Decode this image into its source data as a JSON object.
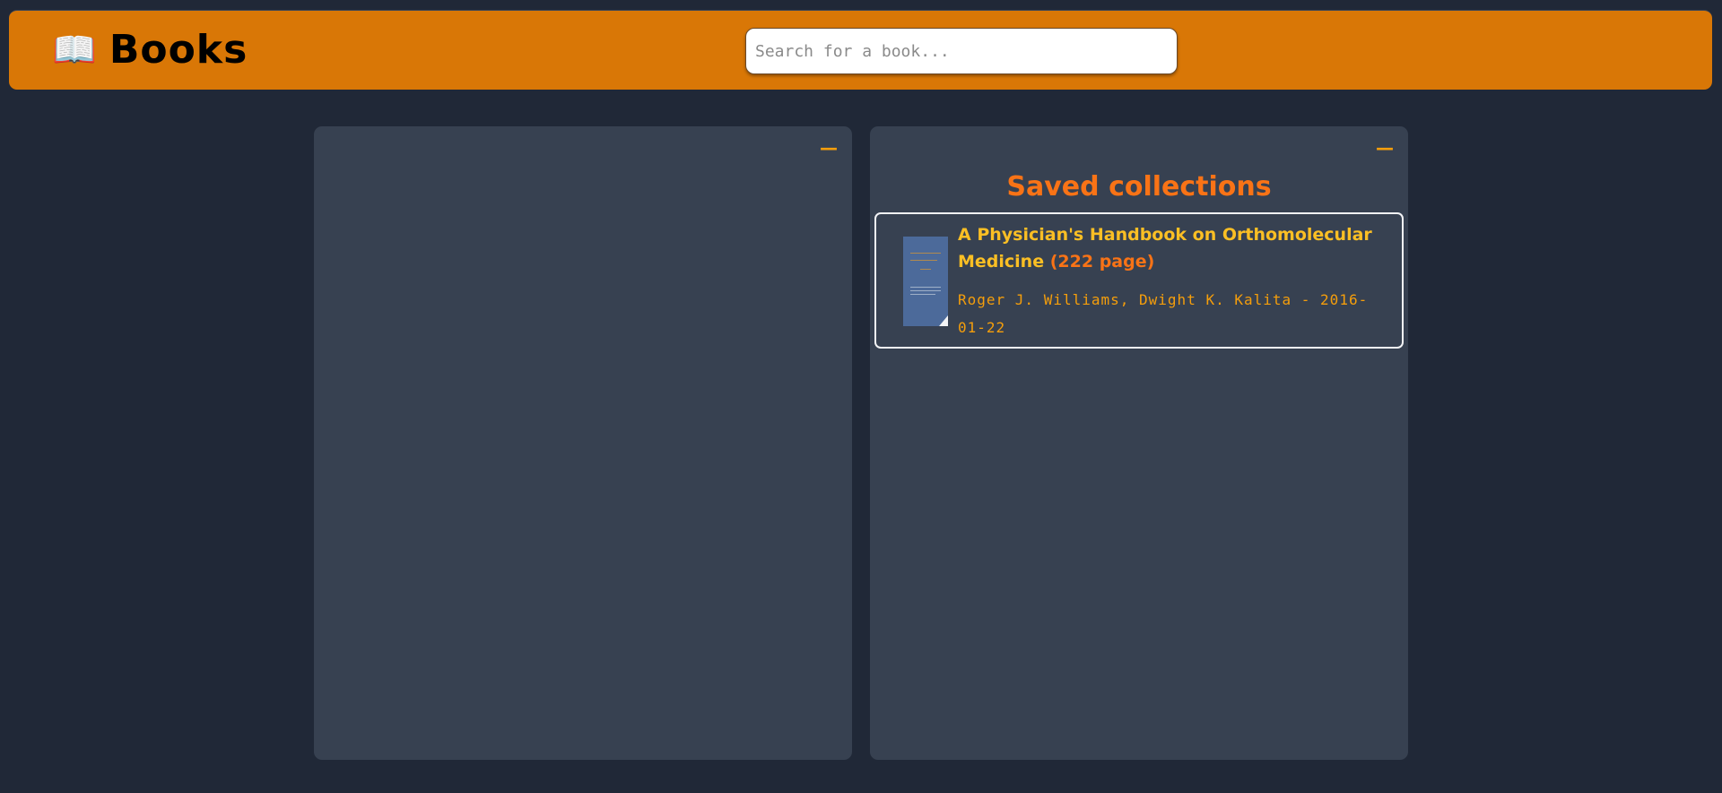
{
  "header": {
    "icon": "open-book-icon",
    "icon_glyph": "📖",
    "title": "Books",
    "search_placeholder": "Search for a book..."
  },
  "colors": {
    "header_bg": "#d97706",
    "page_bg": "#202837",
    "panel_bg": "#374151",
    "accent_orange": "#f97316",
    "accent_amber": "#fbbf24"
  },
  "left_panel": {
    "minimize_label": "—"
  },
  "right_panel": {
    "minimize_label": "—",
    "title": "Saved collections",
    "books": [
      {
        "title": "A Physician's Handbook on Orthomolecular Medicine",
        "pages": "(222 page)",
        "authors_date": "Roger J. Williams, Dwight K. Kalita - 2016-01-22"
      }
    ]
  }
}
